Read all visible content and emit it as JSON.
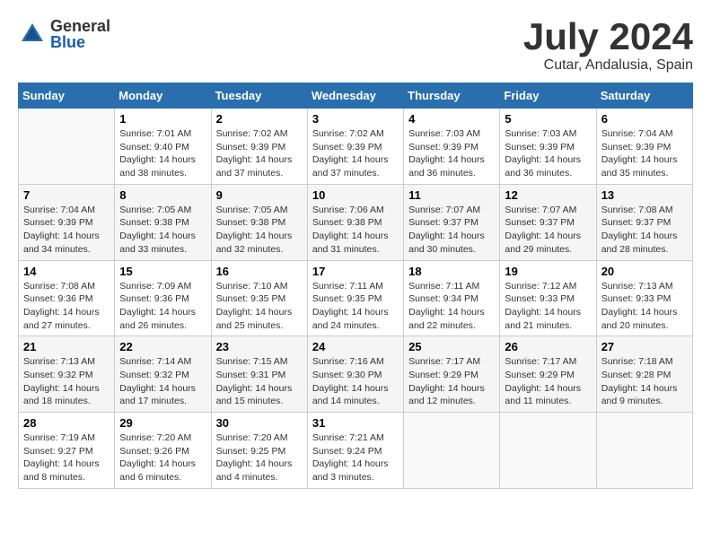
{
  "logo": {
    "general": "General",
    "blue": "Blue"
  },
  "title": {
    "month_year": "July 2024",
    "location": "Cutar, Andalusia, Spain"
  },
  "days_of_week": [
    "Sunday",
    "Monday",
    "Tuesday",
    "Wednesday",
    "Thursday",
    "Friday",
    "Saturday"
  ],
  "weeks": [
    [
      {
        "day": "",
        "info": ""
      },
      {
        "day": "1",
        "info": "Sunrise: 7:01 AM\nSunset: 9:40 PM\nDaylight: 14 hours\nand 38 minutes."
      },
      {
        "day": "2",
        "info": "Sunrise: 7:02 AM\nSunset: 9:39 PM\nDaylight: 14 hours\nand 37 minutes."
      },
      {
        "day": "3",
        "info": "Sunrise: 7:02 AM\nSunset: 9:39 PM\nDaylight: 14 hours\nand 37 minutes."
      },
      {
        "day": "4",
        "info": "Sunrise: 7:03 AM\nSunset: 9:39 PM\nDaylight: 14 hours\nand 36 minutes."
      },
      {
        "day": "5",
        "info": "Sunrise: 7:03 AM\nSunset: 9:39 PM\nDaylight: 14 hours\nand 36 minutes."
      },
      {
        "day": "6",
        "info": "Sunrise: 7:04 AM\nSunset: 9:39 PM\nDaylight: 14 hours\nand 35 minutes."
      }
    ],
    [
      {
        "day": "7",
        "info": "Sunrise: 7:04 AM\nSunset: 9:39 PM\nDaylight: 14 hours\nand 34 minutes."
      },
      {
        "day": "8",
        "info": "Sunrise: 7:05 AM\nSunset: 9:38 PM\nDaylight: 14 hours\nand 33 minutes."
      },
      {
        "day": "9",
        "info": "Sunrise: 7:05 AM\nSunset: 9:38 PM\nDaylight: 14 hours\nand 32 minutes."
      },
      {
        "day": "10",
        "info": "Sunrise: 7:06 AM\nSunset: 9:38 PM\nDaylight: 14 hours\nand 31 minutes."
      },
      {
        "day": "11",
        "info": "Sunrise: 7:07 AM\nSunset: 9:37 PM\nDaylight: 14 hours\nand 30 minutes."
      },
      {
        "day": "12",
        "info": "Sunrise: 7:07 AM\nSunset: 9:37 PM\nDaylight: 14 hours\nand 29 minutes."
      },
      {
        "day": "13",
        "info": "Sunrise: 7:08 AM\nSunset: 9:37 PM\nDaylight: 14 hours\nand 28 minutes."
      }
    ],
    [
      {
        "day": "14",
        "info": "Sunrise: 7:08 AM\nSunset: 9:36 PM\nDaylight: 14 hours\nand 27 minutes."
      },
      {
        "day": "15",
        "info": "Sunrise: 7:09 AM\nSunset: 9:36 PM\nDaylight: 14 hours\nand 26 minutes."
      },
      {
        "day": "16",
        "info": "Sunrise: 7:10 AM\nSunset: 9:35 PM\nDaylight: 14 hours\nand 25 minutes."
      },
      {
        "day": "17",
        "info": "Sunrise: 7:11 AM\nSunset: 9:35 PM\nDaylight: 14 hours\nand 24 minutes."
      },
      {
        "day": "18",
        "info": "Sunrise: 7:11 AM\nSunset: 9:34 PM\nDaylight: 14 hours\nand 22 minutes."
      },
      {
        "day": "19",
        "info": "Sunrise: 7:12 AM\nSunset: 9:33 PM\nDaylight: 14 hours\nand 21 minutes."
      },
      {
        "day": "20",
        "info": "Sunrise: 7:13 AM\nSunset: 9:33 PM\nDaylight: 14 hours\nand 20 minutes."
      }
    ],
    [
      {
        "day": "21",
        "info": "Sunrise: 7:13 AM\nSunset: 9:32 PM\nDaylight: 14 hours\nand 18 minutes."
      },
      {
        "day": "22",
        "info": "Sunrise: 7:14 AM\nSunset: 9:32 PM\nDaylight: 14 hours\nand 17 minutes."
      },
      {
        "day": "23",
        "info": "Sunrise: 7:15 AM\nSunset: 9:31 PM\nDaylight: 14 hours\nand 15 minutes."
      },
      {
        "day": "24",
        "info": "Sunrise: 7:16 AM\nSunset: 9:30 PM\nDaylight: 14 hours\nand 14 minutes."
      },
      {
        "day": "25",
        "info": "Sunrise: 7:17 AM\nSunset: 9:29 PM\nDaylight: 14 hours\nand 12 minutes."
      },
      {
        "day": "26",
        "info": "Sunrise: 7:17 AM\nSunset: 9:29 PM\nDaylight: 14 hours\nand 11 minutes."
      },
      {
        "day": "27",
        "info": "Sunrise: 7:18 AM\nSunset: 9:28 PM\nDaylight: 14 hours\nand 9 minutes."
      }
    ],
    [
      {
        "day": "28",
        "info": "Sunrise: 7:19 AM\nSunset: 9:27 PM\nDaylight: 14 hours\nand 8 minutes."
      },
      {
        "day": "29",
        "info": "Sunrise: 7:20 AM\nSunset: 9:26 PM\nDaylight: 14 hours\nand 6 minutes."
      },
      {
        "day": "30",
        "info": "Sunrise: 7:20 AM\nSunset: 9:25 PM\nDaylight: 14 hours\nand 4 minutes."
      },
      {
        "day": "31",
        "info": "Sunrise: 7:21 AM\nSunset: 9:24 PM\nDaylight: 14 hours\nand 3 minutes."
      },
      {
        "day": "",
        "info": ""
      },
      {
        "day": "",
        "info": ""
      },
      {
        "day": "",
        "info": ""
      }
    ]
  ]
}
